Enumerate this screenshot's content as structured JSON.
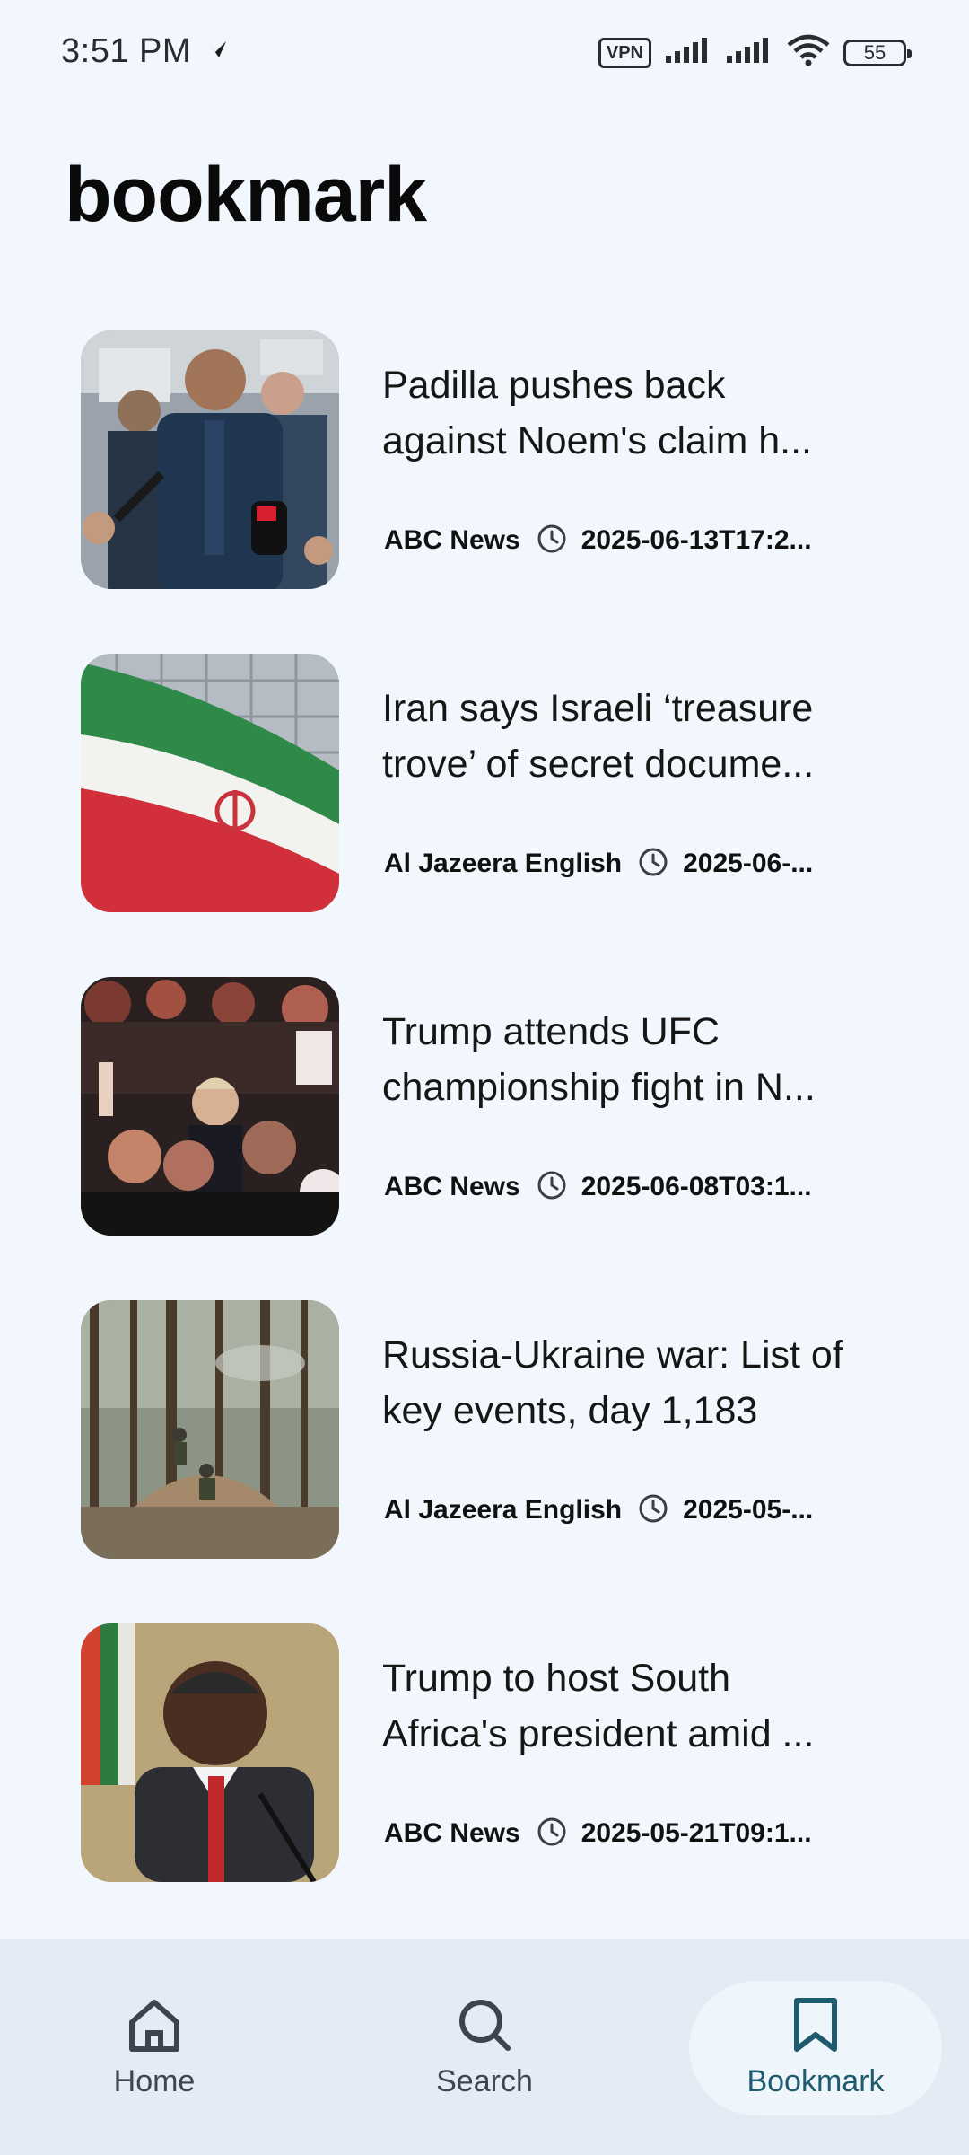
{
  "status_bar": {
    "time": "3:51 PM",
    "vpn": "VPN",
    "battery": "55",
    "icons": [
      "signal-icon",
      "signal-icon",
      "wifi-icon",
      "battery-icon"
    ]
  },
  "page": {
    "title": "bookmark"
  },
  "articles": [
    {
      "headline": "Padilla pushes back against Noem's claim h...",
      "source": "ABC News",
      "time": "2025-06-13T17:2...",
      "thumbnail": "press-scrum-photo"
    },
    {
      "headline": "Iran says Israeli ‘treasure trove’ of secret docume...",
      "source": "Al Jazeera English",
      "time": "2025-06-...",
      "thumbnail": "iran-flag-photo"
    },
    {
      "headline": "Trump attends UFC championship fight in N...",
      "source": "ABC News",
      "time": "2025-06-08T03:1...",
      "thumbnail": "ufc-crowd-photo"
    },
    {
      "headline": "Russia-Ukraine war: List of key events, day 1,183",
      "source": "Al Jazeera English",
      "time": "2025-05-...",
      "thumbnail": "forest-soldiers-photo"
    },
    {
      "headline": "Trump to host South Africa's president amid ...",
      "source": "ABC News",
      "time": "2025-05-21T09:1...",
      "thumbnail": "president-portrait-photo"
    }
  ],
  "bottom_nav": {
    "items": [
      {
        "label": "Home",
        "icon": "home-icon"
      },
      {
        "label": "Search",
        "icon": "search-icon"
      },
      {
        "label": "Bookmark",
        "icon": "bookmark-icon",
        "active": true
      }
    ]
  },
  "colors": {
    "background": "#f1f7fd",
    "nav_background": "#e5ebf4",
    "active_accent": "#1e5b6e"
  }
}
